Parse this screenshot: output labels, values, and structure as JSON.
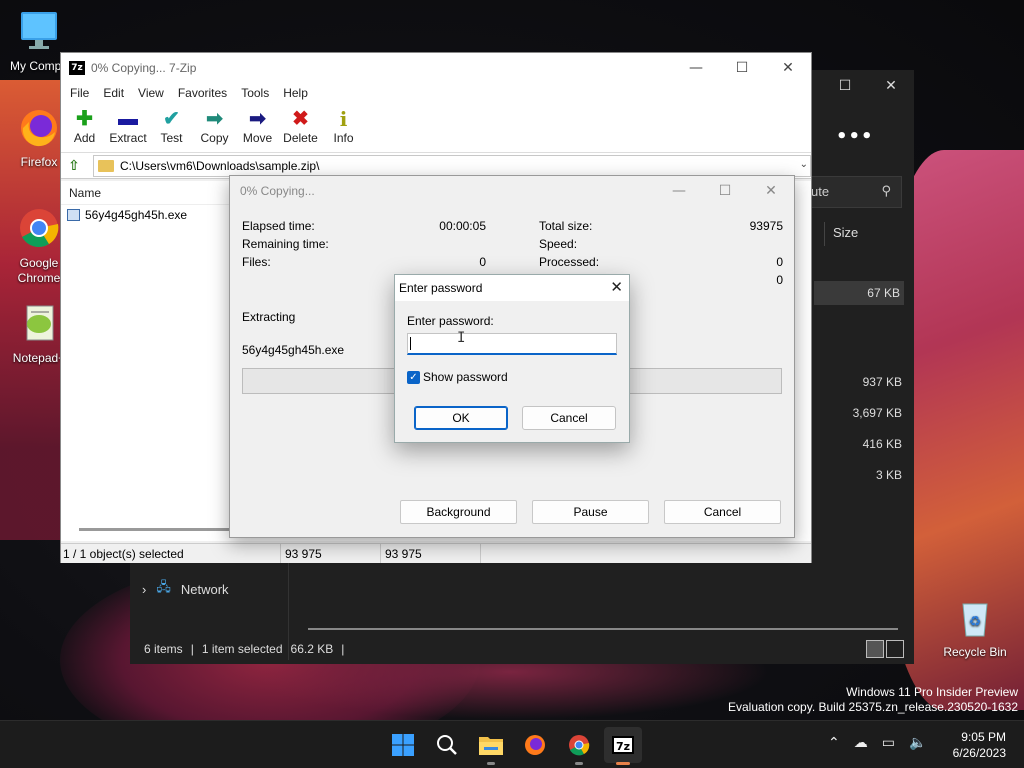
{
  "desktop": {
    "icons": [
      {
        "label": "My Compu"
      },
      {
        "label": "Firefox"
      },
      {
        "label": "Google Chrome"
      },
      {
        "label": "Notepad+"
      },
      {
        "label": "Recycle Bin"
      }
    ]
  },
  "explorer": {
    "search_fragment": "ute",
    "size_header": "Size",
    "sizes": [
      "67 KB",
      "937 KB",
      "3,697 KB",
      "416 KB",
      "3 KB"
    ],
    "network_label": "Network",
    "status_items": "6 items",
    "status_selected": "1 item selected",
    "status_size": "66.2 KB"
  },
  "zip": {
    "title": "0% Copying... 7-Zip",
    "menu": [
      "File",
      "Edit",
      "View",
      "Favorites",
      "Tools",
      "Help"
    ],
    "toolbar": [
      {
        "label": "Add",
        "icon": "add-icon",
        "color": "#1aa01a",
        "glyph": "✚"
      },
      {
        "label": "Extract",
        "icon": "extract-icon",
        "color": "#1a1aa0",
        "glyph": "▬"
      },
      {
        "label": "Test",
        "icon": "test-icon",
        "color": "#20a0a0",
        "glyph": "✔"
      },
      {
        "label": "Copy",
        "icon": "copy-icon",
        "color": "#208a7a",
        "glyph": "➡"
      },
      {
        "label": "Move",
        "icon": "move-icon",
        "color": "#1a1a80",
        "glyph": "➡"
      },
      {
        "label": "Delete",
        "icon": "delete-icon",
        "color": "#d01a1a",
        "glyph": "✖"
      },
      {
        "label": "Info",
        "icon": "info-icon",
        "color": "#a0a010",
        "glyph": "i"
      }
    ],
    "path": "C:\\Users\\vm6\\Downloads\\sample.zip\\",
    "column_name": "Name",
    "files": [
      "56y4g45gh45h.exe"
    ],
    "status": [
      "1 / 1 object(s) selected",
      "93 975",
      "93 975"
    ]
  },
  "progress": {
    "title": "0% Copying...",
    "elapsed_label": "Elapsed time:",
    "elapsed_value": "00:00:05",
    "remaining_label": "Remaining time:",
    "files_label": "Files:",
    "files_value": "0",
    "total_size_label": "Total size:",
    "total_size_value": "93975",
    "speed_label": "Speed:",
    "processed_label": "Processed:",
    "processed_value": "0",
    "extra_value": "0",
    "action": "Extracting",
    "current_file": "56y4g45gh45h.exe",
    "progress_fraction": 0,
    "buttons": {
      "background": "Background",
      "pause": "Pause",
      "cancel": "Cancel"
    }
  },
  "password": {
    "title": "Enter password",
    "label": "Enter password:",
    "value": "",
    "show_password_label": "Show password",
    "show_password_checked": true,
    "ok": "OK",
    "cancel": "Cancel"
  },
  "watermark": {
    "line1": "Windows 11 Pro Insider Preview",
    "line2": "Evaluation copy. Build 25375.zn_release.230520-1632"
  },
  "taskbar": {
    "time": "9:05 PM",
    "date": "6/26/2023",
    "items": [
      "start-icon",
      "search-icon",
      "file-explorer-icon",
      "firefox-icon",
      "chrome-icon",
      "7zip-icon"
    ]
  }
}
